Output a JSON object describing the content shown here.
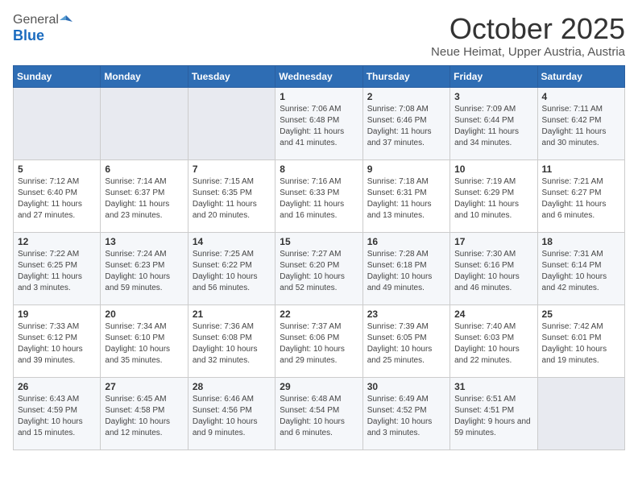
{
  "header": {
    "logo_general": "General",
    "logo_blue": "Blue",
    "month": "October 2025",
    "location": "Neue Heimat, Upper Austria, Austria"
  },
  "weekdays": [
    "Sunday",
    "Monday",
    "Tuesday",
    "Wednesday",
    "Thursday",
    "Friday",
    "Saturday"
  ],
  "weeks": [
    [
      {
        "day": "",
        "content": ""
      },
      {
        "day": "",
        "content": ""
      },
      {
        "day": "",
        "content": ""
      },
      {
        "day": "1",
        "content": "Sunrise: 7:06 AM\nSunset: 6:48 PM\nDaylight: 11 hours and 41 minutes."
      },
      {
        "day": "2",
        "content": "Sunrise: 7:08 AM\nSunset: 6:46 PM\nDaylight: 11 hours and 37 minutes."
      },
      {
        "day": "3",
        "content": "Sunrise: 7:09 AM\nSunset: 6:44 PM\nDaylight: 11 hours and 34 minutes."
      },
      {
        "day": "4",
        "content": "Sunrise: 7:11 AM\nSunset: 6:42 PM\nDaylight: 11 hours and 30 minutes."
      }
    ],
    [
      {
        "day": "5",
        "content": "Sunrise: 7:12 AM\nSunset: 6:40 PM\nDaylight: 11 hours and 27 minutes."
      },
      {
        "day": "6",
        "content": "Sunrise: 7:14 AM\nSunset: 6:37 PM\nDaylight: 11 hours and 23 minutes."
      },
      {
        "day": "7",
        "content": "Sunrise: 7:15 AM\nSunset: 6:35 PM\nDaylight: 11 hours and 20 minutes."
      },
      {
        "day": "8",
        "content": "Sunrise: 7:16 AM\nSunset: 6:33 PM\nDaylight: 11 hours and 16 minutes."
      },
      {
        "day": "9",
        "content": "Sunrise: 7:18 AM\nSunset: 6:31 PM\nDaylight: 11 hours and 13 minutes."
      },
      {
        "day": "10",
        "content": "Sunrise: 7:19 AM\nSunset: 6:29 PM\nDaylight: 11 hours and 10 minutes."
      },
      {
        "day": "11",
        "content": "Sunrise: 7:21 AM\nSunset: 6:27 PM\nDaylight: 11 hours and 6 minutes."
      }
    ],
    [
      {
        "day": "12",
        "content": "Sunrise: 7:22 AM\nSunset: 6:25 PM\nDaylight: 11 hours and 3 minutes."
      },
      {
        "day": "13",
        "content": "Sunrise: 7:24 AM\nSunset: 6:23 PM\nDaylight: 10 hours and 59 minutes."
      },
      {
        "day": "14",
        "content": "Sunrise: 7:25 AM\nSunset: 6:22 PM\nDaylight: 10 hours and 56 minutes."
      },
      {
        "day": "15",
        "content": "Sunrise: 7:27 AM\nSunset: 6:20 PM\nDaylight: 10 hours and 52 minutes."
      },
      {
        "day": "16",
        "content": "Sunrise: 7:28 AM\nSunset: 6:18 PM\nDaylight: 10 hours and 49 minutes."
      },
      {
        "day": "17",
        "content": "Sunrise: 7:30 AM\nSunset: 6:16 PM\nDaylight: 10 hours and 46 minutes."
      },
      {
        "day": "18",
        "content": "Sunrise: 7:31 AM\nSunset: 6:14 PM\nDaylight: 10 hours and 42 minutes."
      }
    ],
    [
      {
        "day": "19",
        "content": "Sunrise: 7:33 AM\nSunset: 6:12 PM\nDaylight: 10 hours and 39 minutes."
      },
      {
        "day": "20",
        "content": "Sunrise: 7:34 AM\nSunset: 6:10 PM\nDaylight: 10 hours and 35 minutes."
      },
      {
        "day": "21",
        "content": "Sunrise: 7:36 AM\nSunset: 6:08 PM\nDaylight: 10 hours and 32 minutes."
      },
      {
        "day": "22",
        "content": "Sunrise: 7:37 AM\nSunset: 6:06 PM\nDaylight: 10 hours and 29 minutes."
      },
      {
        "day": "23",
        "content": "Sunrise: 7:39 AM\nSunset: 6:05 PM\nDaylight: 10 hours and 25 minutes."
      },
      {
        "day": "24",
        "content": "Sunrise: 7:40 AM\nSunset: 6:03 PM\nDaylight: 10 hours and 22 minutes."
      },
      {
        "day": "25",
        "content": "Sunrise: 7:42 AM\nSunset: 6:01 PM\nDaylight: 10 hours and 19 minutes."
      }
    ],
    [
      {
        "day": "26",
        "content": "Sunrise: 6:43 AM\nSunset: 4:59 PM\nDaylight: 10 hours and 15 minutes."
      },
      {
        "day": "27",
        "content": "Sunrise: 6:45 AM\nSunset: 4:58 PM\nDaylight: 10 hours and 12 minutes."
      },
      {
        "day": "28",
        "content": "Sunrise: 6:46 AM\nSunset: 4:56 PM\nDaylight: 10 hours and 9 minutes."
      },
      {
        "day": "29",
        "content": "Sunrise: 6:48 AM\nSunset: 4:54 PM\nDaylight: 10 hours and 6 minutes."
      },
      {
        "day": "30",
        "content": "Sunrise: 6:49 AM\nSunset: 4:52 PM\nDaylight: 10 hours and 3 minutes."
      },
      {
        "day": "31",
        "content": "Sunrise: 6:51 AM\nSunset: 4:51 PM\nDaylight: 9 hours and 59 minutes."
      },
      {
        "day": "",
        "content": ""
      }
    ]
  ]
}
